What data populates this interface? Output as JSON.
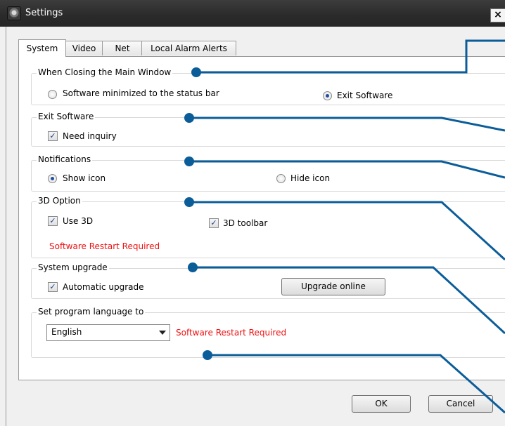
{
  "window": {
    "title": "Settings",
    "close_label": "×",
    "icon": "app-camera-icon"
  },
  "tabs": [
    {
      "label": "System",
      "active": true
    },
    {
      "label": "Video"
    },
    {
      "label": "Net"
    },
    {
      "label": "Local Alarm Alerts"
    }
  ],
  "groups": {
    "closing": {
      "title": "When Closing the Main Window",
      "option_minimize": "Software minimized to the status bar",
      "option_exit": "Exit Software",
      "selected": "Exit Software"
    },
    "exit_software": {
      "title": "Exit Software",
      "need_inquiry": "Need inquiry",
      "need_inquiry_checked": true
    },
    "notifications": {
      "title": "Notifications",
      "show_icon": "Show icon",
      "hide_icon": "Hide icon",
      "selected": "Show icon"
    },
    "three_d": {
      "title": "3D Option",
      "use_3d": "Use 3D",
      "use_3d_checked": true,
      "toolbar_3d": "3D toolbar",
      "toolbar_3d_checked": true,
      "restart_note": "Software Restart Required"
    },
    "upgrade": {
      "title": "System upgrade",
      "auto_upgrade": "Automatic upgrade",
      "auto_upgrade_checked": true,
      "upgrade_button": "Upgrade online"
    },
    "language": {
      "title": "Set program language to",
      "selected_language": "English",
      "restart_note": "Software Restart Required"
    }
  },
  "buttons": {
    "ok": "OK",
    "cancel": "Cancel"
  },
  "colors": {
    "callout": "#0b5d99",
    "warning": "#ee1111",
    "titlebar": "#2f2f2f"
  }
}
